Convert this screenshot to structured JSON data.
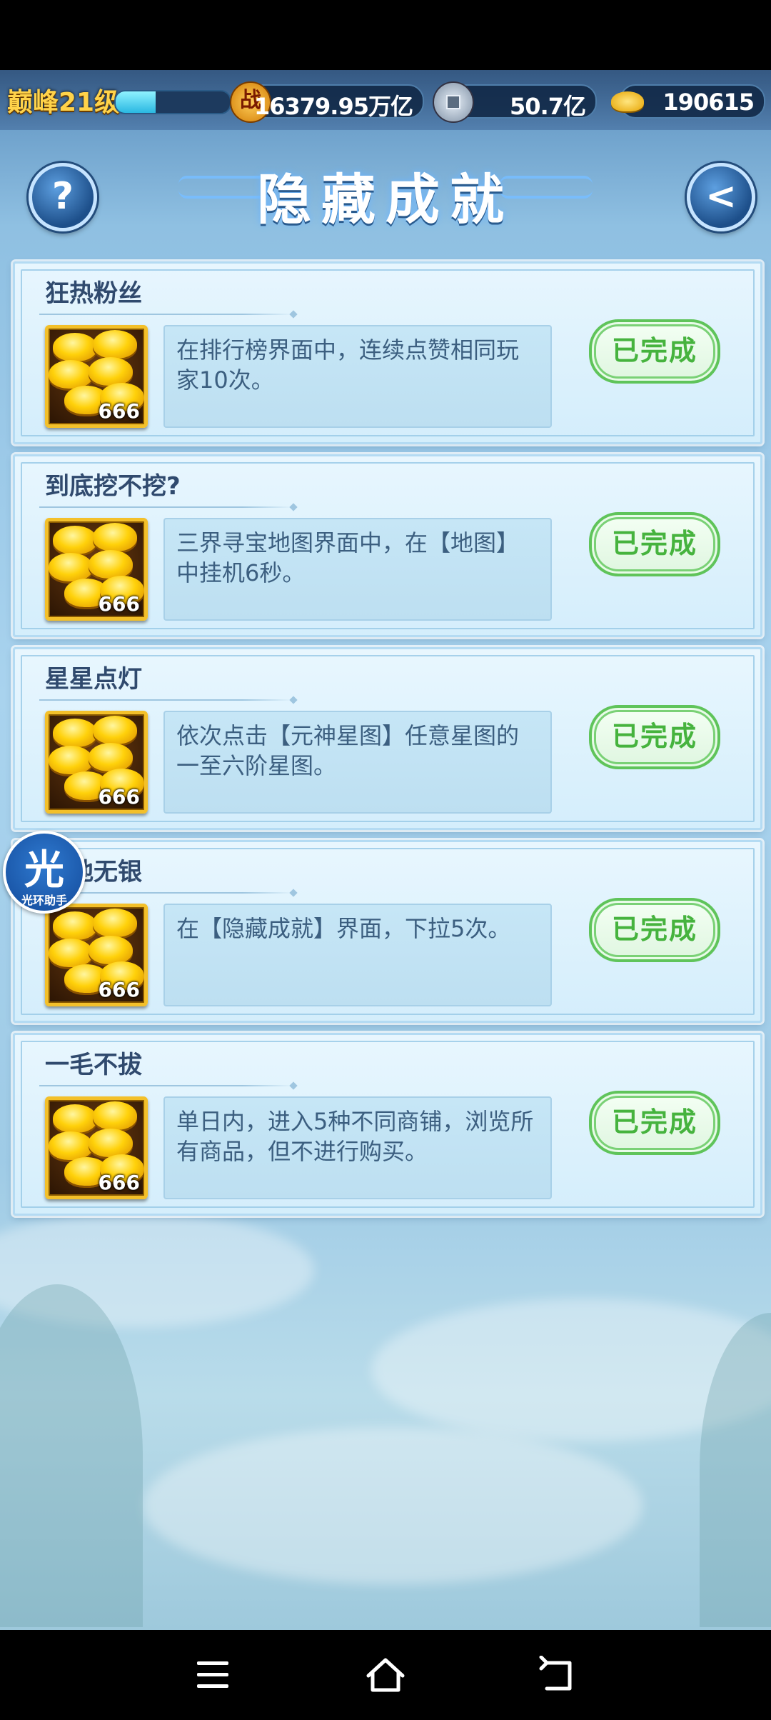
{
  "topbar": {
    "level": "巅峰21级",
    "exp_progress": 0.35,
    "battle_icon_glyph": "战",
    "battle_power": "16379.95万亿",
    "silver": "50.7亿",
    "gold": "190615"
  },
  "header": {
    "title": "隐藏成就",
    "help_glyph": "?",
    "back_glyph": "<"
  },
  "achievements": [
    {
      "title": "狂热粉丝",
      "reward_count": "666",
      "description": "在排行榜界面中，连续点赞相同玩家10次。",
      "status": "已完成"
    },
    {
      "title": "到底挖不挖?",
      "reward_count": "666",
      "description": "三界寻宝地图界面中，在【地图】中挂机6秒。",
      "status": "已完成"
    },
    {
      "title": "星星点灯",
      "reward_count": "666",
      "description": "依次点击【元神星图】任意星图的一至六阶星图。",
      "status": "已完成"
    },
    {
      "title": "此地无银",
      "reward_count": "666",
      "description": "在【隐藏成就】界面，下拉5次。",
      "status": "已完成"
    },
    {
      "title": "一毛不拔",
      "reward_count": "666",
      "description": "单日内，进入5种不同商铺，浏览所有商品，但不进行购买。",
      "status": "已完成"
    }
  ],
  "assistant": {
    "glyph": "光",
    "label": "光环助手"
  },
  "icons": [
    "battle-icon",
    "silver-coin-icon",
    "gold-ingot-icon",
    "help-icon",
    "back-arrow-icon",
    "menu-icon",
    "home-icon",
    "back-icon"
  ]
}
